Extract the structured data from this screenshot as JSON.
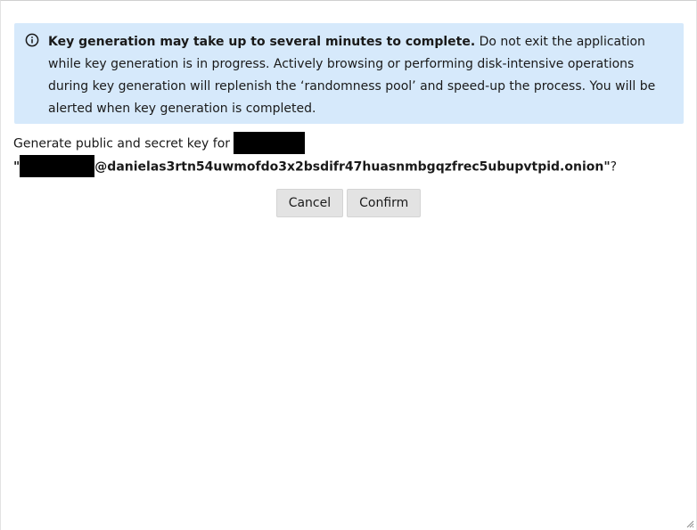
{
  "notice": {
    "icon": "info-icon",
    "strong_text": "Key generation may take up to several minutes to complete.",
    "body_text": " Do not exit the application while key generation is in progress. Actively browsing or performing disk-intensive operations during key generation will replenish the ‘randomness pool’ and speed-up the process. You will be alerted when key generation is completed.",
    "background": "#d6e9fb"
  },
  "prompt": {
    "prefix": "Generate public and secret key for ",
    "open_quote": "\"",
    "address_suffix": "@danielas3rtn54uwmofdo3x2bsdifr47huasnmbgqzfrec5ubupvtpid.onion",
    "close_quote": "\"",
    "question_mark": "?"
  },
  "actions": {
    "cancel_label": "Cancel",
    "confirm_label": "Confirm"
  }
}
